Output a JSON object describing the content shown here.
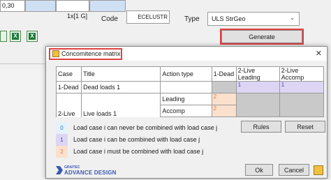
{
  "background": {
    "grid_first_cell": "0,30",
    "field_value": "1x[1 G]",
    "code_label": "Code",
    "code_value": "ECELUSTR",
    "type_label": "Type",
    "type_value": "ULS StrGeo",
    "generate_label": "Generate"
  },
  "dialog": {
    "title": "Concomitence matrix",
    "headers": [
      "Case",
      "Title",
      "Action type",
      "1-Dead",
      "2-Live Leading",
      "2-Live Accomp"
    ],
    "row1": {
      "case": "1-Dead",
      "title": "Dead loads 1",
      "v_live_leading": "1",
      "v_live_accomp": "1"
    },
    "row2": {
      "case": "2-Live",
      "title": "Live loads 1",
      "action_leading": "Leading",
      "action_accomp": "Accomp",
      "v_dead_leading": "2",
      "v_dead_accomp": "2"
    },
    "legend": [
      {
        "code": "0",
        "text": "Load case i can never be combined with load case j"
      },
      {
        "code": "1",
        "text": "Load case i can be combined with load case j"
      },
      {
        "code": "2",
        "text": "Load case i must be combined with load case j"
      }
    ],
    "rules_label": "Rules",
    "reset_label": "Reset",
    "ok_label": "Ok",
    "cancel_label": "Cancel",
    "logo_brand": "GRAITEC",
    "logo_product": "ADVANCE DESIGN"
  },
  "colors": {
    "highlight_outline": "#e04040",
    "code_0": "#e4f2fb",
    "code_1": "#dcd6f4",
    "code_2": "#fbe0cc",
    "disabled": "#c9c9c9"
  }
}
